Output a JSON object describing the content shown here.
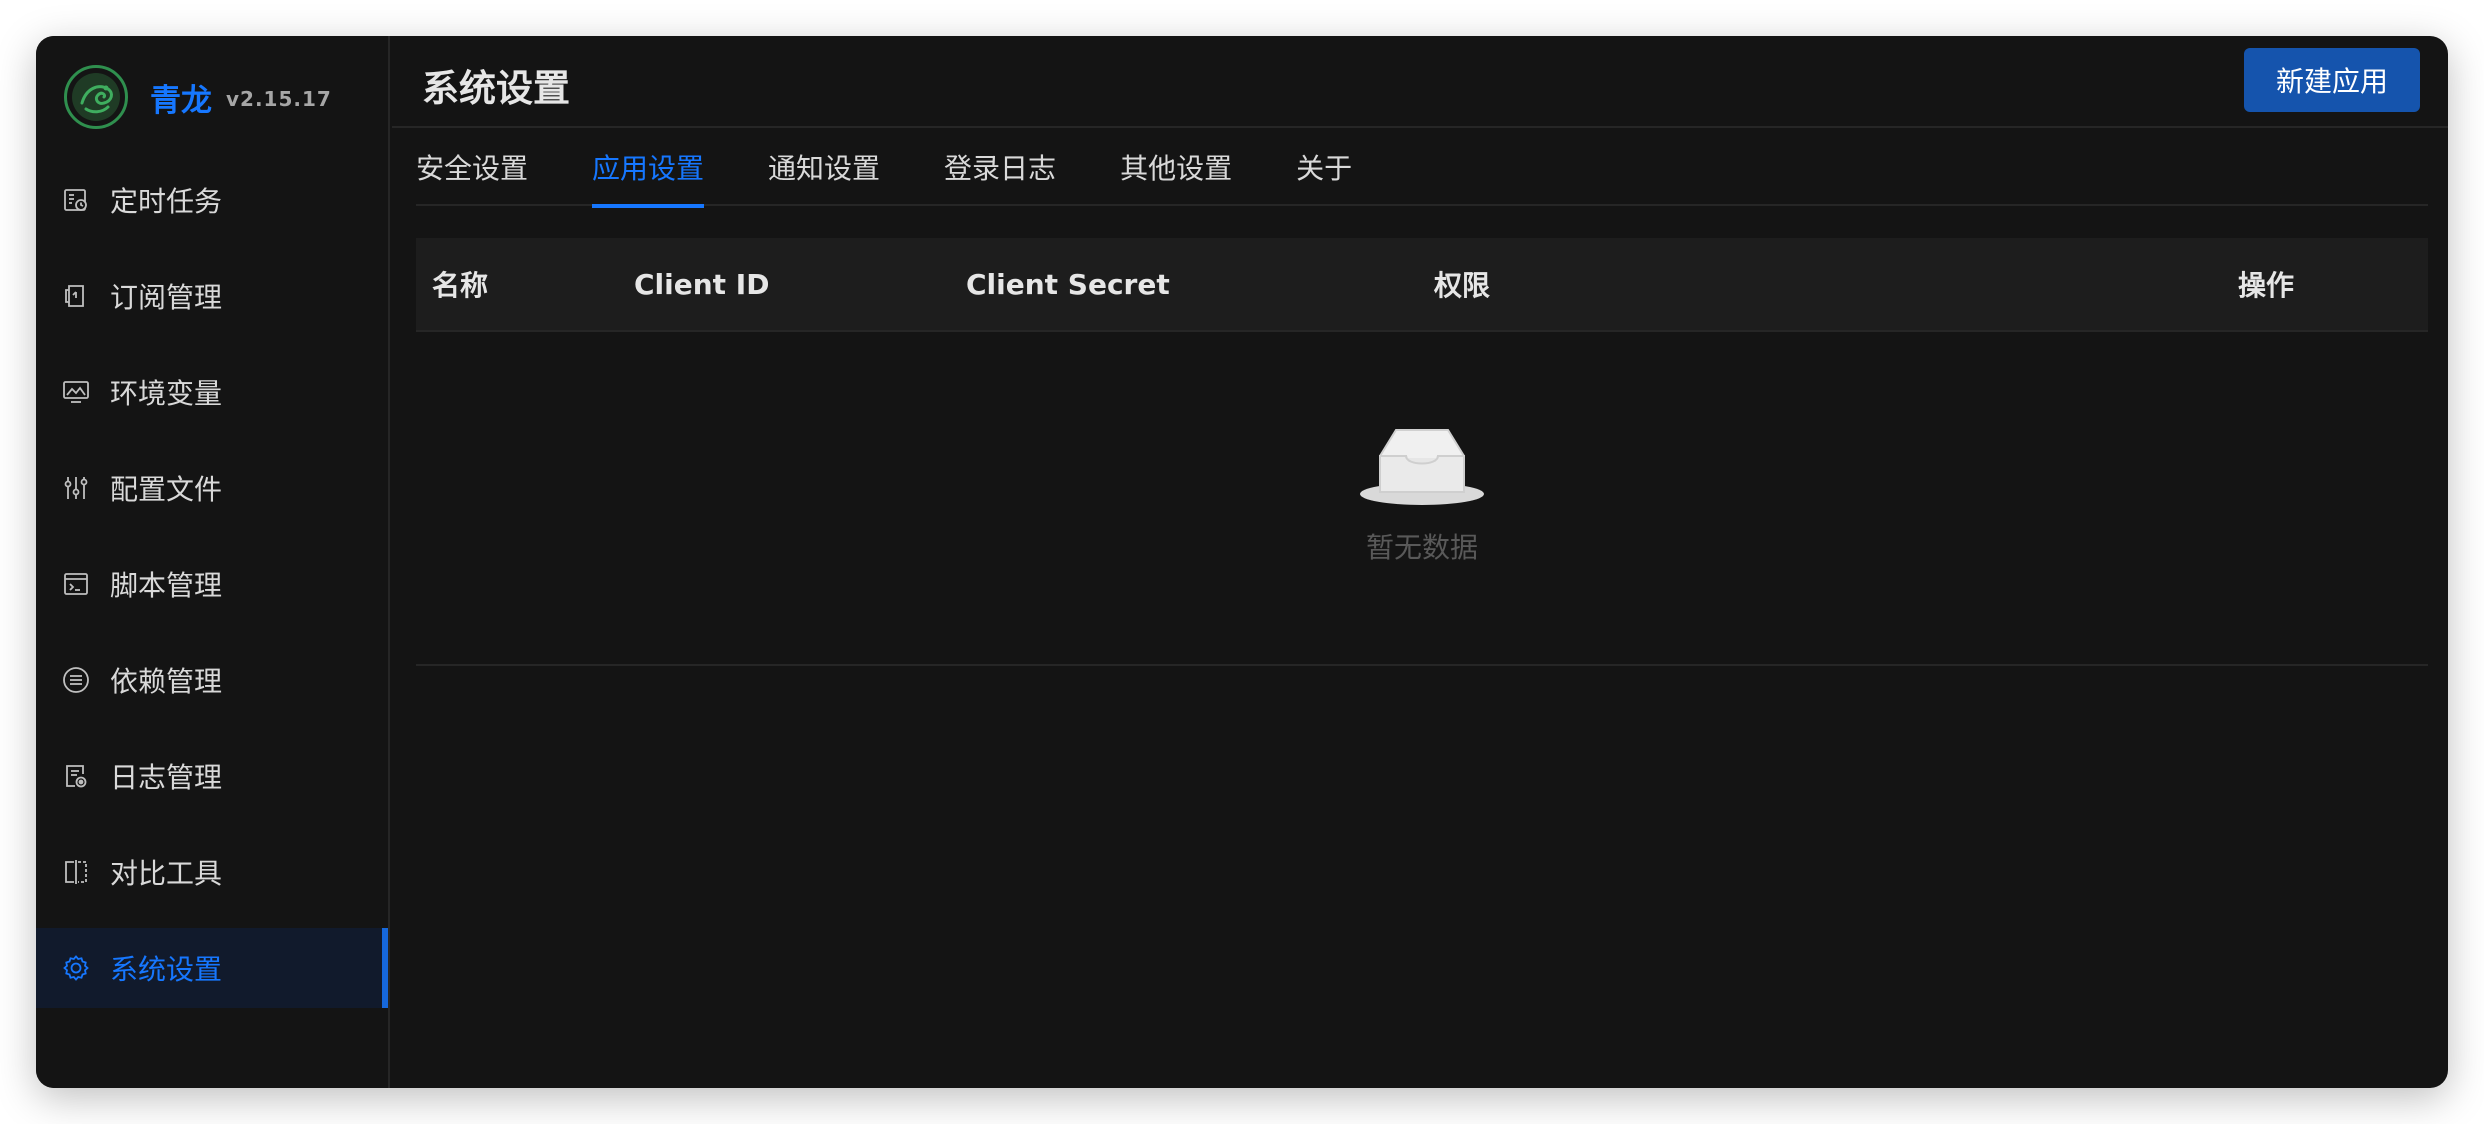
{
  "app": {
    "name": "青龙",
    "version": "v2.15.17"
  },
  "sidebar": {
    "items": [
      {
        "label": "定时任务",
        "icon": "calendar-clock-icon"
      },
      {
        "label": "订阅管理",
        "icon": "subscription-icon"
      },
      {
        "label": "环境变量",
        "icon": "monitor-image-icon"
      },
      {
        "label": "配置文件",
        "icon": "sliders-icon"
      },
      {
        "label": "脚本管理",
        "icon": "code-window-icon"
      },
      {
        "label": "依赖管理",
        "icon": "list-circle-icon"
      },
      {
        "label": "日志管理",
        "icon": "log-file-icon"
      },
      {
        "label": "对比工具",
        "icon": "diff-icon"
      },
      {
        "label": "系统设置",
        "icon": "gear-icon"
      }
    ],
    "active_index": 8
  },
  "header": {
    "title": "系统设置",
    "new_app_label": "新建应用"
  },
  "tabs": [
    {
      "label": "安全设置"
    },
    {
      "label": "应用设置"
    },
    {
      "label": "通知设置"
    },
    {
      "label": "登录日志"
    },
    {
      "label": "其他设置"
    },
    {
      "label": "关于"
    }
  ],
  "active_tab": 1,
  "table": {
    "columns": [
      "名称",
      "Client ID",
      "Client Secret",
      "权限",
      "操作"
    ],
    "rows": [],
    "empty_text": "暂无数据"
  },
  "colors": {
    "accent": "#1677ff",
    "button": "#1554ad",
    "background": "#141414",
    "active_menu_bg": "#111a2c"
  }
}
